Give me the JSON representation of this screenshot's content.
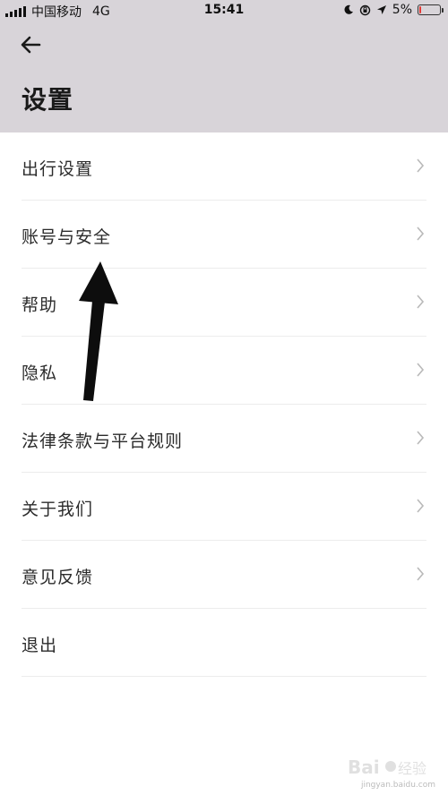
{
  "status_bar": {
    "carrier": "中国移动",
    "network": "4G",
    "time": "15:41",
    "battery": "5%",
    "battery_level": 0.05,
    "battery_color": "#e53935"
  },
  "header": {
    "title": "设置",
    "background": "#d8d4d9"
  },
  "menu": [
    {
      "label": "出行设置",
      "chevron": true
    },
    {
      "label": "账号与安全",
      "chevron": true
    },
    {
      "label": "帮助",
      "chevron": true
    },
    {
      "label": "隐私",
      "chevron": true
    },
    {
      "label": "法律条款与平台规则",
      "chevron": true
    },
    {
      "label": "关于我们",
      "chevron": true
    },
    {
      "label": "意见反馈",
      "chevron": true
    },
    {
      "label": "退出",
      "chevron": false
    }
  ],
  "watermark": {
    "text": "jingyan.baidu.com"
  }
}
